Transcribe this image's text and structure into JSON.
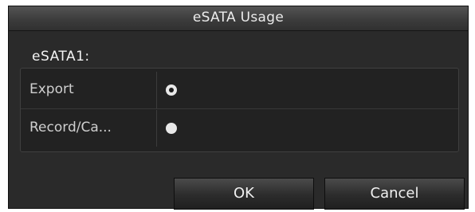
{
  "dialog": {
    "title": "eSATA Usage",
    "device_label": "eSATA1:",
    "options": [
      {
        "label": "Export",
        "selected": true
      },
      {
        "label": "Record/Ca...",
        "selected": false
      }
    ],
    "buttons": {
      "ok_label": "OK",
      "cancel_label": "Cancel"
    }
  },
  "colors": {
    "dialog_background": "#2a2a2a",
    "title_bar": "#3c3c3c",
    "text": "#f2f2f2"
  }
}
